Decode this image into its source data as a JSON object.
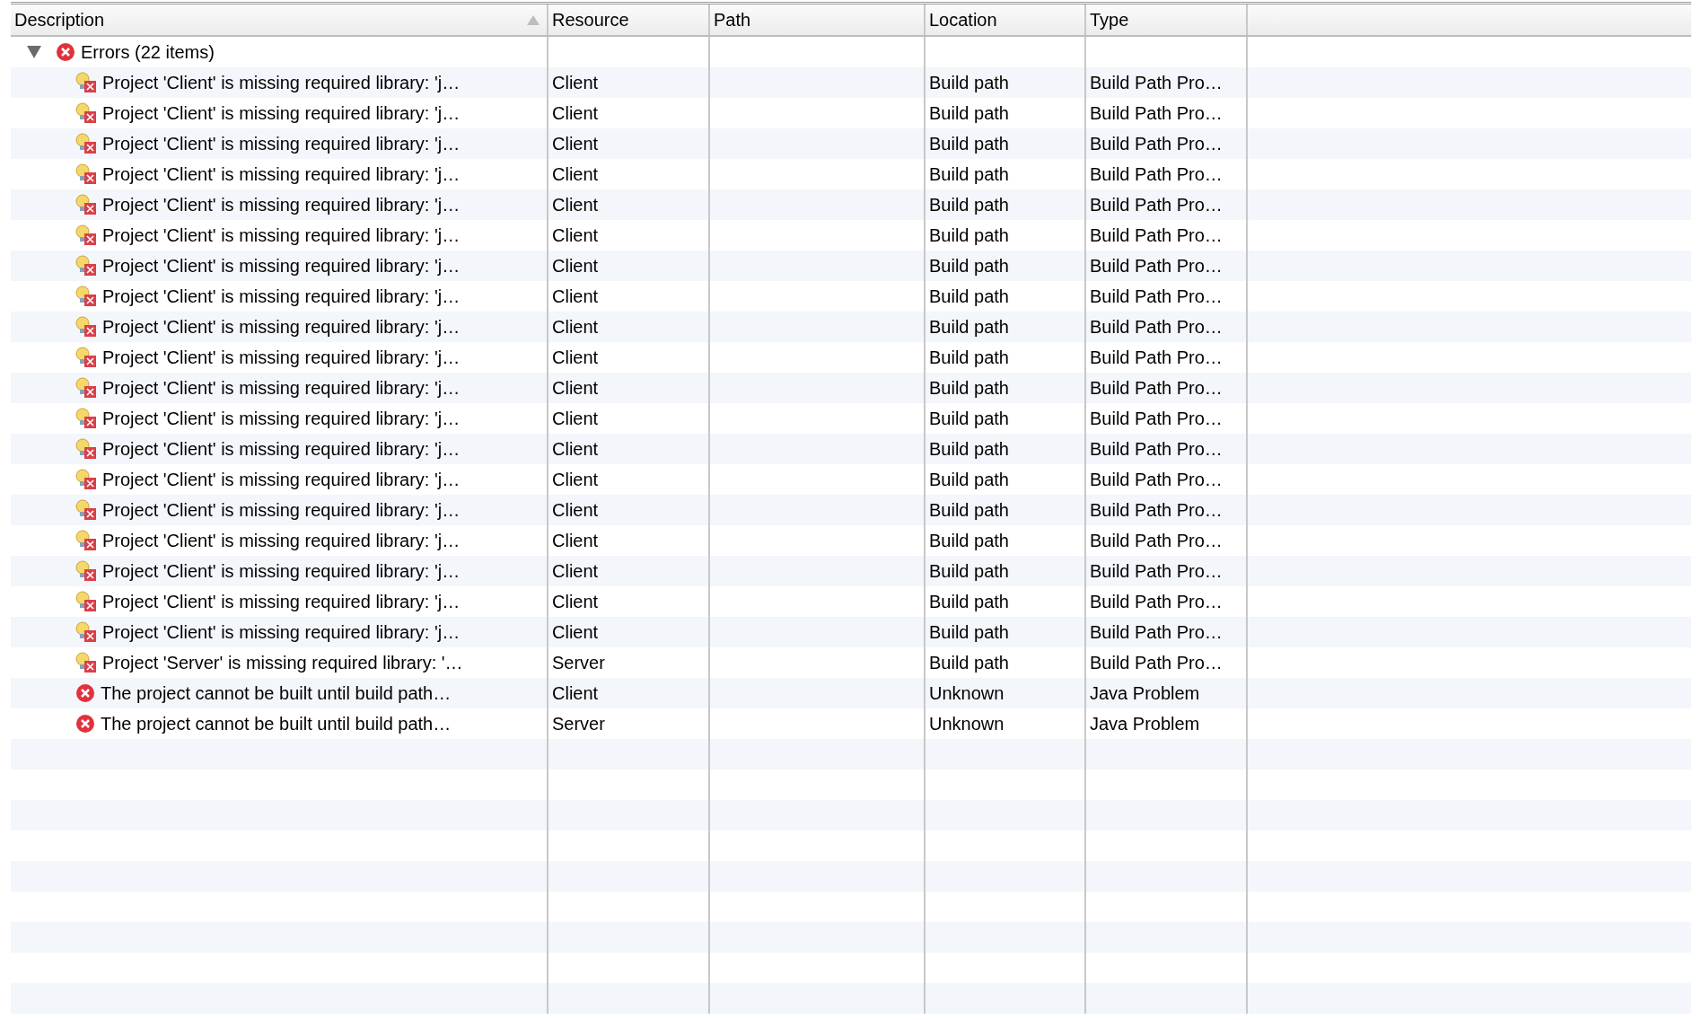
{
  "table": {
    "columns": [
      {
        "label": "Description",
        "sorted": true
      },
      {
        "label": "Resource",
        "sorted": false
      },
      {
        "label": "Path",
        "sorted": false
      },
      {
        "label": "Location",
        "sorted": false
      },
      {
        "label": "Type",
        "sorted": false
      }
    ],
    "groups": [
      {
        "label": "Errors (22 items)",
        "expanded": true,
        "rows": [
          {
            "kind": "library",
            "description": "Project 'Client' is missing required library: 'j…",
            "resource": "Client",
            "location": "Build path",
            "type": "Build Path Pro…"
          },
          {
            "kind": "library",
            "description": "Project 'Client' is missing required library: 'j…",
            "resource": "Client",
            "location": "Build path",
            "type": "Build Path Pro…"
          },
          {
            "kind": "library",
            "description": "Project 'Client' is missing required library: 'j…",
            "resource": "Client",
            "location": "Build path",
            "type": "Build Path Pro…"
          },
          {
            "kind": "library",
            "description": "Project 'Client' is missing required library: 'j…",
            "resource": "Client",
            "location": "Build path",
            "type": "Build Path Pro…"
          },
          {
            "kind": "library",
            "description": "Project 'Client' is missing required library: 'j…",
            "resource": "Client",
            "location": "Build path",
            "type": "Build Path Pro…"
          },
          {
            "kind": "library",
            "description": "Project 'Client' is missing required library: 'j…",
            "resource": "Client",
            "location": "Build path",
            "type": "Build Path Pro…"
          },
          {
            "kind": "library",
            "description": "Project 'Client' is missing required library: 'j…",
            "resource": "Client",
            "location": "Build path",
            "type": "Build Path Pro…"
          },
          {
            "kind": "library",
            "description": "Project 'Client' is missing required library: 'j…",
            "resource": "Client",
            "location": "Build path",
            "type": "Build Path Pro…"
          },
          {
            "kind": "library",
            "description": "Project 'Client' is missing required library: 'j…",
            "resource": "Client",
            "location": "Build path",
            "type": "Build Path Pro…"
          },
          {
            "kind": "library",
            "description": "Project 'Client' is missing required library: 'j…",
            "resource": "Client",
            "location": "Build path",
            "type": "Build Path Pro…"
          },
          {
            "kind": "library",
            "description": "Project 'Client' is missing required library: 'j…",
            "resource": "Client",
            "location": "Build path",
            "type": "Build Path Pro…"
          },
          {
            "kind": "library",
            "description": "Project 'Client' is missing required library: 'j…",
            "resource": "Client",
            "location": "Build path",
            "type": "Build Path Pro…"
          },
          {
            "kind": "library",
            "description": "Project 'Client' is missing required library: 'j…",
            "resource": "Client",
            "location": "Build path",
            "type": "Build Path Pro…"
          },
          {
            "kind": "library",
            "description": "Project 'Client' is missing required library: 'j…",
            "resource": "Client",
            "location": "Build path",
            "type": "Build Path Pro…"
          },
          {
            "kind": "library",
            "description": "Project 'Client' is missing required library: 'j…",
            "resource": "Client",
            "location": "Build path",
            "type": "Build Path Pro…"
          },
          {
            "kind": "library",
            "description": "Project 'Client' is missing required library: 'j…",
            "resource": "Client",
            "location": "Build path",
            "type": "Build Path Pro…"
          },
          {
            "kind": "library",
            "description": "Project 'Client' is missing required library: 'j…",
            "resource": "Client",
            "location": "Build path",
            "type": "Build Path Pro…"
          },
          {
            "kind": "library",
            "description": "Project 'Client' is missing required library: 'j…",
            "resource": "Client",
            "location": "Build path",
            "type": "Build Path Pro…"
          },
          {
            "kind": "library",
            "description": "Project 'Client' is missing required library: 'j…",
            "resource": "Client",
            "location": "Build path",
            "type": "Build Path Pro…"
          },
          {
            "kind": "library",
            "description": "Project 'Server' is missing required library: '…",
            "resource": "Server",
            "location": "Build path",
            "type": "Build Path Pro…"
          },
          {
            "kind": "error",
            "description": "The project cannot be built until build path…",
            "resource": "Client",
            "location": "Unknown",
            "type": "Java Problem"
          },
          {
            "kind": "error",
            "description": "The project cannot be built until build path…",
            "resource": "Server",
            "location": "Unknown",
            "type": "Java Problem"
          }
        ]
      }
    ]
  }
}
